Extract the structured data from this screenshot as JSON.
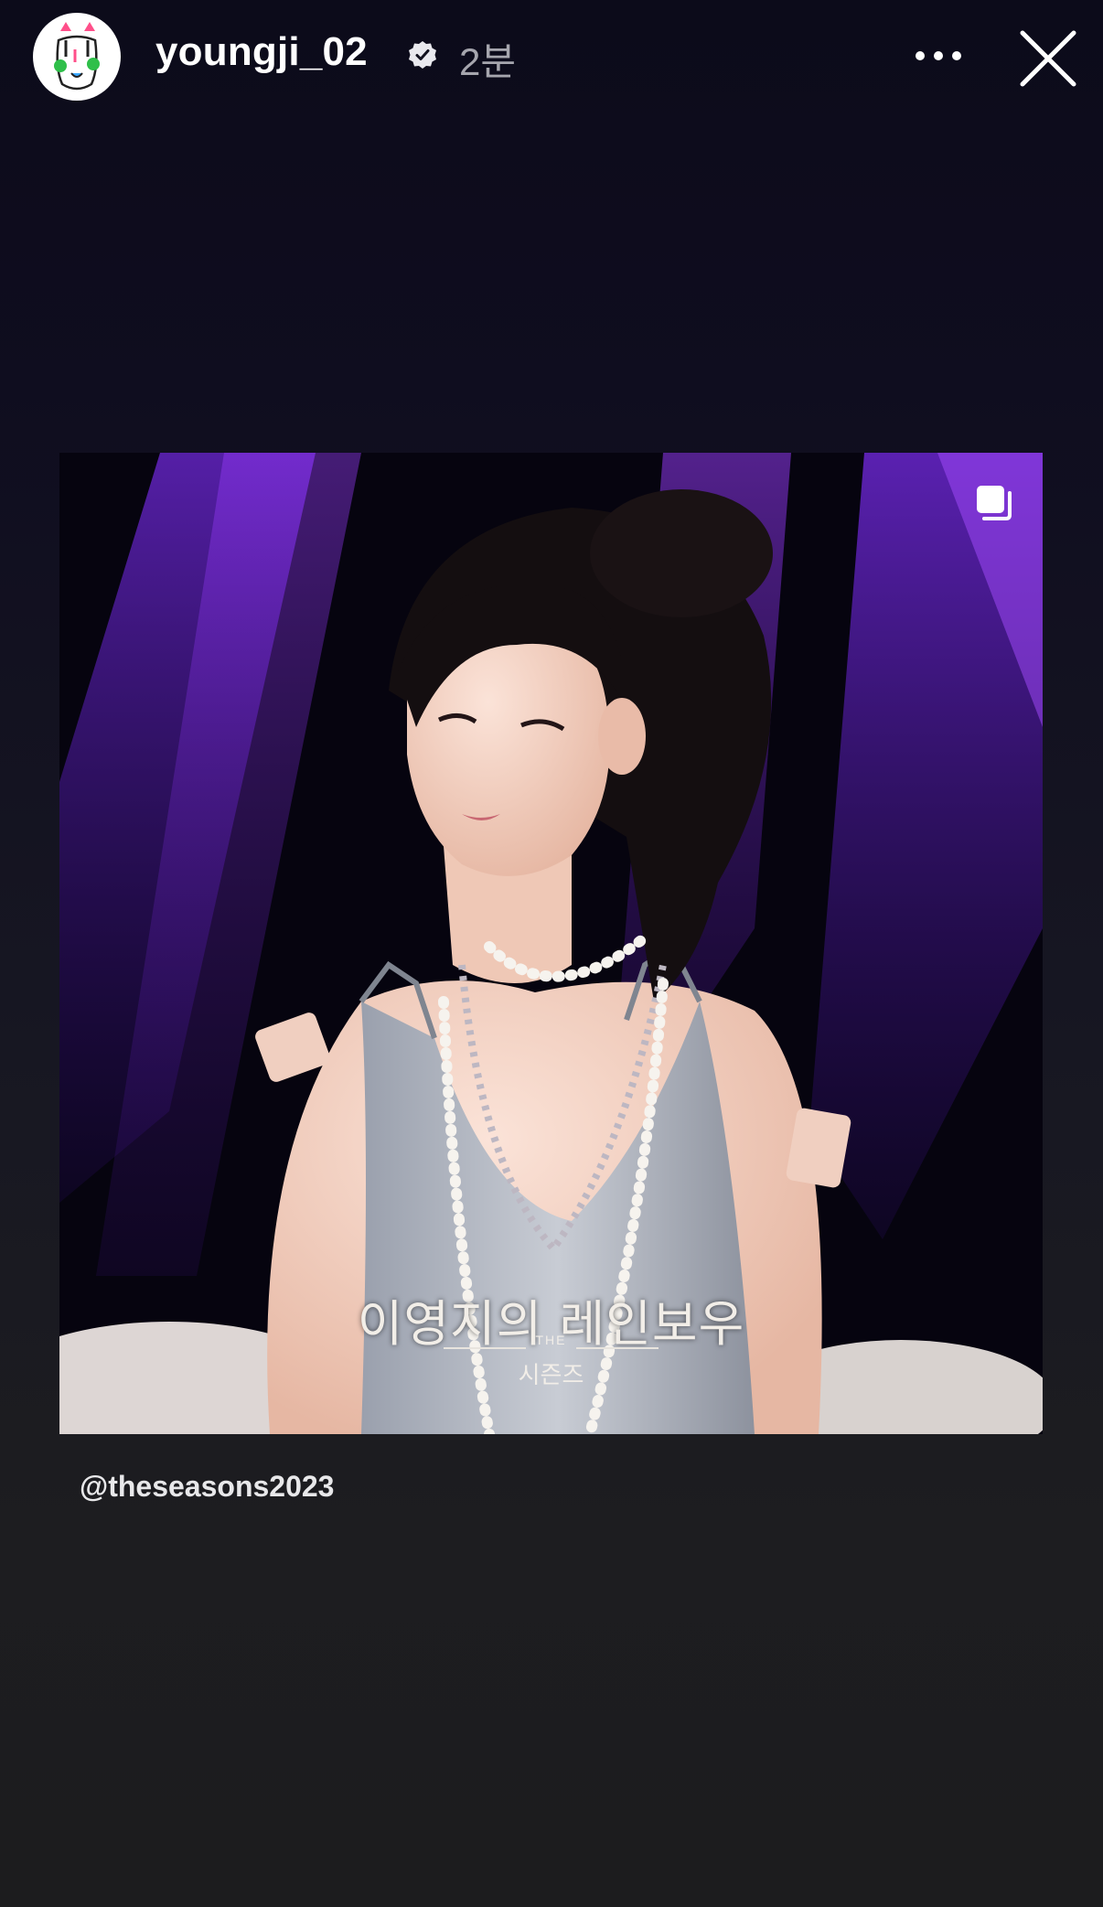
{
  "header": {
    "username": "youngji_02",
    "time_ago": "2분",
    "verified": true
  },
  "post": {
    "watermark_title": "이영지의 레인보우",
    "watermark_the": "THE",
    "watermark_sub": "시즌즈",
    "multi_image": true
  },
  "mention": {
    "label": "@theseasons2023"
  },
  "icons": {
    "verified": "verified-badge-icon",
    "more": "more-options-icon",
    "close": "close-icon",
    "carousel": "carousel-icon"
  },
  "colors": {
    "background": "#1c1c1e",
    "stage_purple": "#7a2be8",
    "text": "#ffffff",
    "muted": "#a6a6ae"
  }
}
